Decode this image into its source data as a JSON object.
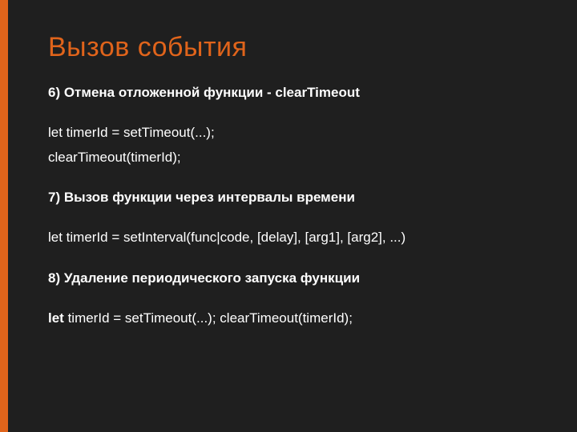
{
  "title": "Вызов события",
  "sections": {
    "s6": {
      "heading": "6) Отмена отложенной функции - clearTimeout",
      "code1": "let timerId = setTimeout(...);",
      "code2": "clearTimeout(timerId);"
    },
    "s7": {
      "heading": "7) Вызов функции через интервалы времени",
      "code1": "let timerId = setInterval(func|code, [delay], [arg1], [arg2], ...)"
    },
    "s8": {
      "heading": "8) Удаление периодического запуска функции",
      "letword": "let",
      "rest": " timerId = setTimeout(...); clearTimeout(timerId);"
    }
  }
}
